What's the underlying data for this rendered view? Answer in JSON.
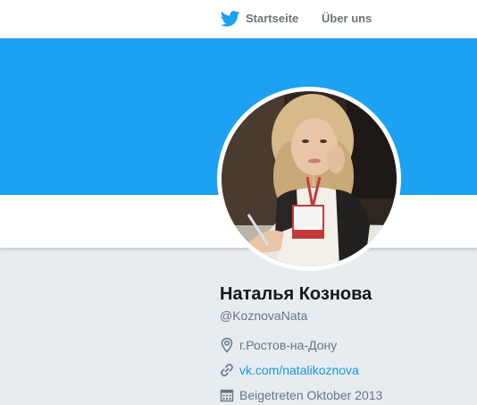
{
  "nav": {
    "home_label": "Startseite",
    "about_label": "Über uns"
  },
  "colors": {
    "brand_blue": "#1da1f2",
    "link_blue": "#1b95e0",
    "background": "#e6ecf0",
    "muted_text": "#657786",
    "name_text": "#14171a"
  },
  "icons": {
    "home": "twitter-bird-icon",
    "location": "location-pin-icon",
    "url": "link-icon",
    "joined": "calendar-icon"
  },
  "profile": {
    "name": "Наталья Кознова",
    "handle": "@KoznovaNata",
    "location": "г.Ростов-на-Дону",
    "url": "vk.com/natalikoznova",
    "joined": "Beigetreten Oktober 2013"
  }
}
